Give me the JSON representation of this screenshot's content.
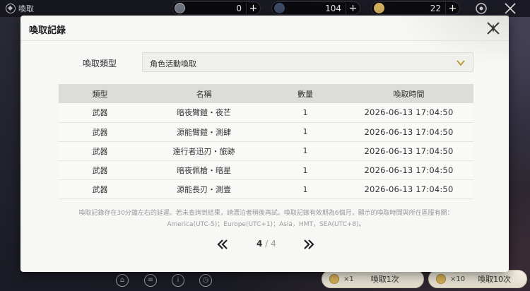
{
  "topbar": {
    "title": "喚取",
    "resources": [
      {
        "icon": "pass-icon",
        "value": "0"
      },
      {
        "icon": "star-crystal-icon",
        "value": "104"
      },
      {
        "icon": "coin-icon",
        "value": "22"
      }
    ]
  },
  "modal": {
    "title": "喚取記錄",
    "filter_label": "喚取類型",
    "filter_value": "角色活動喚取",
    "table": {
      "headers": [
        "類型",
        "名稱",
        "數量",
        "喚取時間"
      ],
      "rows": [
        [
          "武器",
          "暗夜臂鎧・夜芒",
          "1",
          "2026-06-13 17:04:50"
        ],
        [
          "武器",
          "源能臂鎧・測肆",
          "1",
          "2026-06-13 17:04:50"
        ],
        [
          "武器",
          "遠行者迅刃・旅跡",
          "1",
          "2026-06-13 17:04:50"
        ],
        [
          "武器",
          "暗夜佩槍・暗星",
          "1",
          "2026-06-13 17:04:50"
        ],
        [
          "武器",
          "源能長刃・測壹",
          "1",
          "2026-06-13 17:04:50"
        ]
      ]
    },
    "notice_line1": "喚取記錄存在30分鐘左右的延遲。若未查詢到結果，請漂泊者稍後再試。喚取記錄有效期為6個月，顯示的喚取時間與所在區服有關：",
    "notice_line2": "America(UTC-5)；Europe(UTC+1)；Asia，HMT，SEA(UTC+8)。",
    "pager": {
      "current": "4",
      "separator": "/",
      "total": "4"
    }
  },
  "bottom": {
    "draw1": {
      "mult": "×1",
      "label": "喚取1次"
    },
    "draw10": {
      "mult": "×10",
      "label": "喚取10次"
    }
  }
}
